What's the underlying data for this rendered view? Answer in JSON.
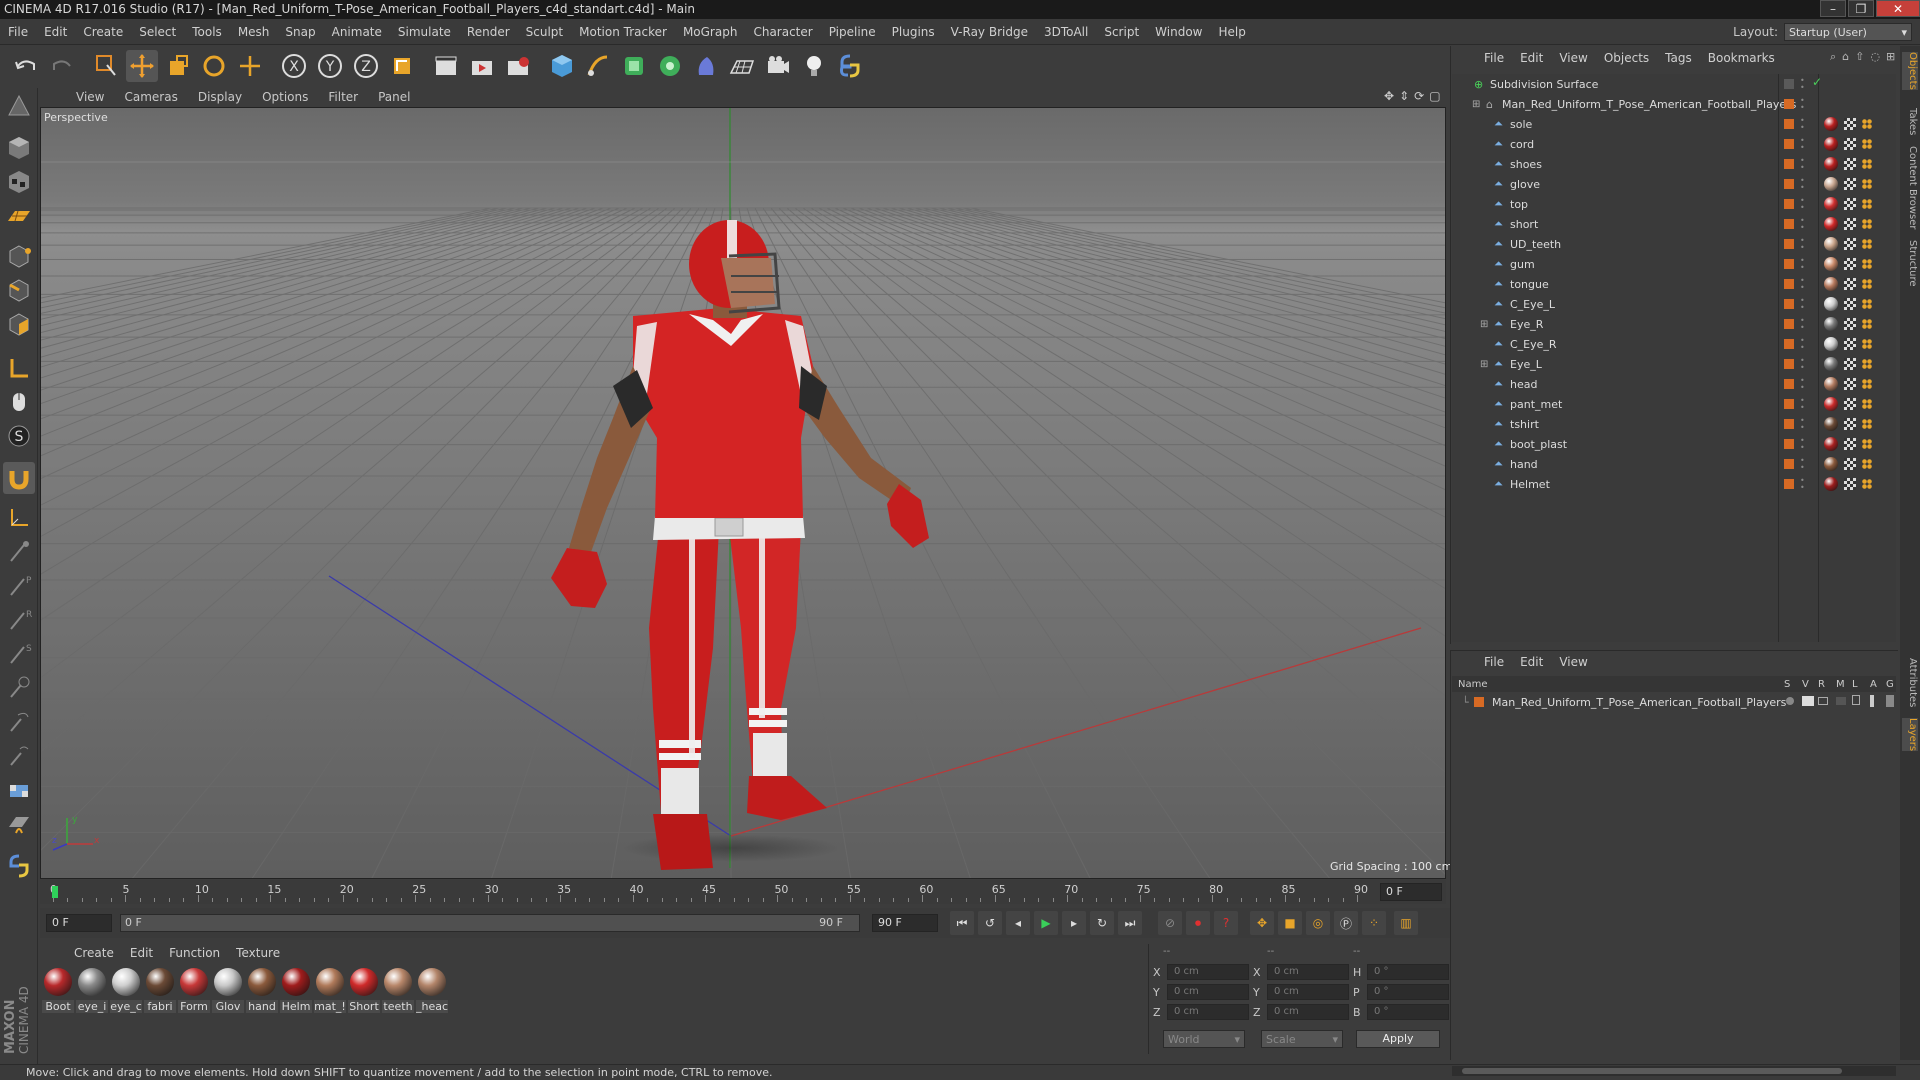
{
  "window": {
    "title": "CINEMA 4D R17.016 Studio (R17) - [Man_Red_Uniform_T-Pose_American_Football_Players_c4d_standart.c4d] - Main",
    "minimize": "–",
    "maximize": "❐",
    "close": "✕"
  },
  "menubar": [
    "File",
    "Edit",
    "Create",
    "Select",
    "Tools",
    "Mesh",
    "Snap",
    "Animate",
    "Simulate",
    "Render",
    "Sculpt",
    "Motion Tracker",
    "MoGraph",
    "Character",
    "Pipeline",
    "Plugins",
    "V-Ray Bridge",
    "3DToAll",
    "Script",
    "Window",
    "Help"
  ],
  "layout": {
    "label": "Layout:",
    "value": "Startup (User)"
  },
  "viewport": {
    "menu": [
      "View",
      "Cameras",
      "Display",
      "Options",
      "Filter",
      "Panel"
    ],
    "camera": "Perspective",
    "grid_spacing": "Grid Spacing : 100 cm",
    "axis_y": "y",
    "axis_x": "x",
    "axis_z": "z"
  },
  "timeline": {
    "ticks": [
      "0",
      "5",
      "10",
      "15",
      "20",
      "25",
      "30",
      "35",
      "40",
      "45",
      "50",
      "55",
      "60",
      "65",
      "70",
      "75",
      "80",
      "85",
      "90"
    ],
    "current_frame": "0 F",
    "start": "0 F",
    "range_start": "0 F",
    "range_end": "90 F",
    "end": "90 F"
  },
  "materials": {
    "menu": [
      "Create",
      "Edit",
      "Function",
      "Texture"
    ],
    "items": [
      {
        "label": "Boot",
        "color": "#b8292b"
      },
      {
        "label": "eye_i",
        "color": "#8a8a8a"
      },
      {
        "label": "eye_c",
        "color": "#cfcfcf"
      },
      {
        "label": "fabri",
        "color": "#6b4a36"
      },
      {
        "label": "Form",
        "color": "#c73838"
      },
      {
        "label": "Glov",
        "color": "#c9c9c9"
      },
      {
        "label": "hand",
        "color": "#8b5a3c"
      },
      {
        "label": "Helm",
        "color": "#a01c1c"
      },
      {
        "label": "mat_!",
        "color": "#b07a5a"
      },
      {
        "label": "Short",
        "color": "#cf2a2a"
      },
      {
        "label": "teeth",
        "color": "#b8876a"
      },
      {
        "label": "_heac",
        "color": "#b3856a"
      }
    ]
  },
  "coordinates": {
    "header": [
      "--",
      "--",
      "--"
    ],
    "rows": [
      {
        "a": "X",
        "av": "0 cm",
        "b": "X",
        "bv": "0 cm",
        "c": "H",
        "cv": "0 °"
      },
      {
        "a": "Y",
        "av": "0 cm",
        "b": "Y",
        "bv": "0 cm",
        "c": "P",
        "cv": "0 °"
      },
      {
        "a": "Z",
        "av": "0 cm",
        "b": "Z",
        "bv": "0 cm",
        "c": "B",
        "cv": "0 °"
      }
    ],
    "mode": "World",
    "type": "Scale",
    "apply": "Apply"
  },
  "status": "Move: Click and drag to move elements. Hold down SHIFT to quantize movement / add to the selection in point mode, CTRL to remove.",
  "object_manager": {
    "menu": [
      "File",
      "Edit",
      "View",
      "Objects",
      "Tags",
      "Bookmarks"
    ],
    "root": "Subdivision Surface",
    "group": "Man_Red_Uniform_T_Pose_American_Football_Players",
    "objects": [
      {
        "name": "sole",
        "tag": "#b81f1f"
      },
      {
        "name": "cord",
        "tag": "#b81f1f"
      },
      {
        "name": "shoes",
        "tag": "#b81f1f"
      },
      {
        "name": "glove",
        "tag": "#c7a58f"
      },
      {
        "name": "top",
        "tag": "#d23030"
      },
      {
        "name": "short",
        "tag": "#d02828"
      },
      {
        "name": "UD_teeth",
        "tag": "#c9a48a"
      },
      {
        "name": "gum",
        "tag": "#c98a6a"
      },
      {
        "name": "tongue",
        "tag": "#b77a5e"
      },
      {
        "name": "C_Eye_L",
        "tag": "#cccccc"
      },
      {
        "name": "Eye_R",
        "tag": "#7a7a7a"
      },
      {
        "name": "C_Eye_R",
        "tag": "#cccccc"
      },
      {
        "name": "Eye_L",
        "tag": "#7a7a7a"
      },
      {
        "name": "head",
        "tag": "#b27b60"
      },
      {
        "name": "pant_met",
        "tag": "#c92a2a"
      },
      {
        "name": "tshirt",
        "tag": "#6b4a36"
      },
      {
        "name": "boot_plast",
        "tag": "#a82020"
      },
      {
        "name": "hand",
        "tag": "#8b5a3c"
      },
      {
        "name": "Helmet",
        "tag": "#9a1c1c"
      }
    ]
  },
  "layer_manager": {
    "menu": [
      "File",
      "Edit",
      "View"
    ],
    "columns": [
      "Name",
      "S",
      "V",
      "R",
      "M",
      "L",
      "A",
      "G"
    ],
    "layer": "Man_Red_Uniform_T_Pose_American_Football_Players"
  },
  "right_tabs": [
    "Objects",
    "Takes",
    "Content Browser",
    "Structure",
    "Attributes",
    "Layers"
  ],
  "brand": "MAXON CINEMA 4D"
}
